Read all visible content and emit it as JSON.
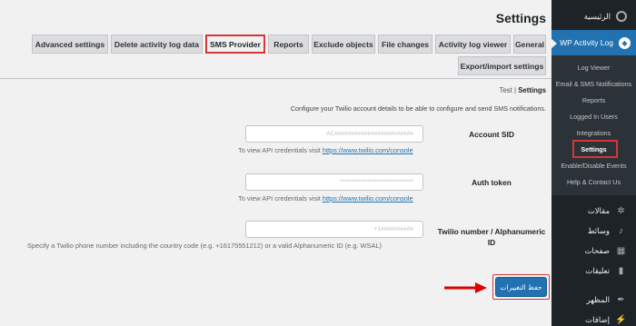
{
  "page": {
    "title": "Settings"
  },
  "sidebar": {
    "top_items": [
      {
        "label": "الرئيسية",
        "icon": "dashboard-icon"
      }
    ],
    "plugin_item": {
      "label": "WP Activity Log",
      "icon": "shield-icon"
    },
    "submenu": [
      {
        "label": "Log Viewer"
      },
      {
        "label": "Email & SMS Notifications"
      },
      {
        "label": "Reports"
      },
      {
        "label": "Logged In Users"
      },
      {
        "label": "Integrations"
      },
      {
        "label": "Settings",
        "current": true
      },
      {
        "label": "Enable/Disable Events"
      },
      {
        "label": "Help & Contact Us"
      }
    ],
    "bottom_items": [
      {
        "label": "مقالات",
        "icon": "pin-icon"
      },
      {
        "label": "وسائط",
        "icon": "media-icon"
      },
      {
        "label": "صفحات",
        "icon": "pages-icon"
      },
      {
        "label": "تعليقات",
        "icon": "comments-icon"
      },
      {
        "label": "المظهر",
        "icon": "appearance-icon"
      },
      {
        "label": "إضافات",
        "icon": "plugins-icon"
      }
    ]
  },
  "tabs": {
    "row1": [
      "General",
      "Activity log viewer",
      "File changes",
      "Exclude objects",
      "Reports",
      "SMS Provider",
      "Delete activity log data",
      "Advanced settings"
    ],
    "row2": [
      "Export/import settings"
    ],
    "active": "SMS Provider"
  },
  "subnav": {
    "test": "Test",
    "sep": "|",
    "settings": "Settings"
  },
  "description": "Configure your Twilio account details to be able to configure and send SMS notifications.",
  "fields": {
    "account_sid": {
      "label": "Account SID",
      "value": "AC########################",
      "help_prefix": "To view API credentials visit",
      "help_link": "https://www.twilio.com/console"
    },
    "auth_token": {
      "label": "Auth token",
      "value": "********************************",
      "help_prefix": "To view API credentials visit",
      "help_link": "https://www.twilio.com/console"
    },
    "twilio_number": {
      "label_line1": "Twilio number / Alphanumeric",
      "label_line2": "ID",
      "value": "+1##########",
      "help": "Specify a Twilio phone number including the country code (e.g. +16175551212) or a valid Alphanumeric ID (e.g. WSAL)"
    }
  },
  "submit": {
    "label": "حفظ التغييرات"
  },
  "colors": {
    "accent": "#2271b1",
    "highlight": "#d63638",
    "sidebar": "#1d2327"
  }
}
